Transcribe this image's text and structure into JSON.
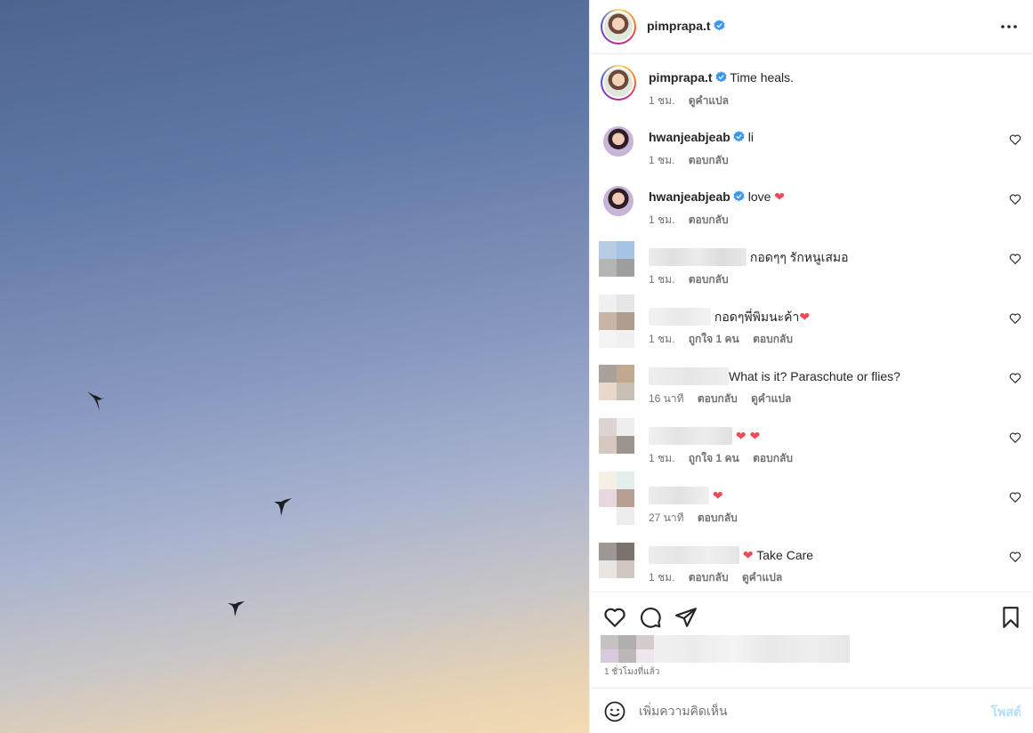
{
  "post": {
    "author": "pimprapa.t",
    "caption": "Time heals.",
    "caption_time": "1 ชม.",
    "caption_translate": "ดูคำแปล",
    "more_icon": "more-horizontal-icon"
  },
  "comments": [
    {
      "user": "hwanjeabjeab",
      "verified": true,
      "text": "li",
      "time": "1 ชม.",
      "actions": [
        "ตอบกลับ"
      ]
    },
    {
      "user": "hwanjeabjeab",
      "verified": true,
      "text": "love",
      "heart": true,
      "time": "1 ชม.",
      "actions": [
        "ตอบกลับ"
      ]
    },
    {
      "user": "",
      "text": "กอดๆๆ รักหนูเสมอ",
      "time": "1 ชม.",
      "actions": [
        "ตอบกลับ"
      ]
    },
    {
      "user": "",
      "text": "กอดๆพี่พิมนะค้า",
      "heart": true,
      "time": "1 ชม.",
      "actions": [
        "ถูกใจ 1 คน",
        "ตอบกลับ"
      ]
    },
    {
      "user": "",
      "text": "What is it? Paraschute or flies?",
      "time": "16 นาที",
      "actions": [
        "ตอบกลับ",
        "ดูคำแปล"
      ]
    },
    {
      "user": "",
      "text": "",
      "hearts": 2,
      "time": "1 ชม.",
      "actions": [
        "ถูกใจ 1 คน",
        "ตอบกลับ"
      ]
    },
    {
      "user": "",
      "text": "",
      "hearts": 1,
      "time": "27 นาที",
      "actions": [
        "ตอบกลับ"
      ]
    },
    {
      "user": "",
      "text": "Take Care",
      "heart": true,
      "time": "1 ชม.",
      "actions": [
        "ตอบกลับ",
        "ดูคำแปล"
      ]
    }
  ],
  "footer": {
    "time_ago": "1 ชั่วโมงที่แล้ว",
    "comment_placeholder": "เพิ่มความคิดเห็น",
    "post_label": "โพสต์"
  },
  "colors": {
    "verified": "#3897f0",
    "heart": "#ed4956",
    "post_disabled": "#b2dffc"
  }
}
